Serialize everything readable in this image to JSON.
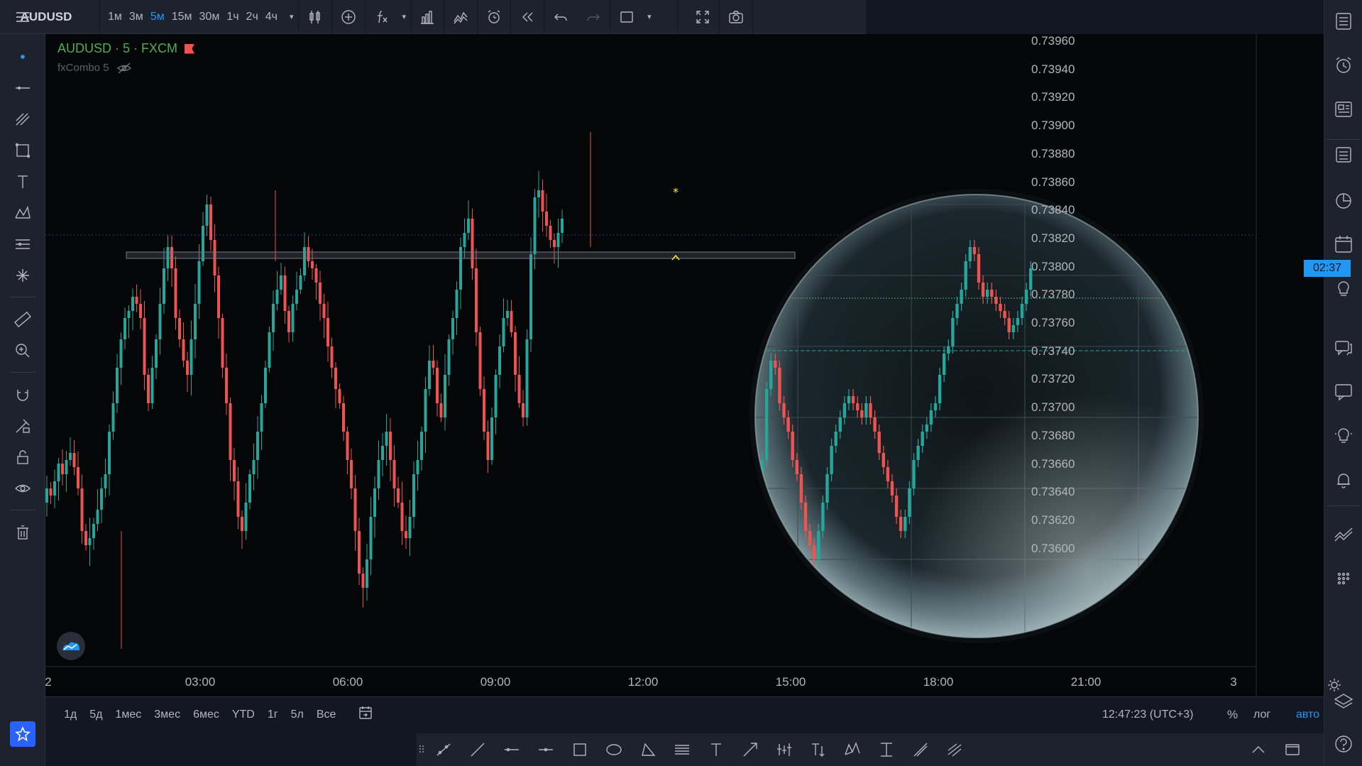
{
  "topbar": {
    "symbol": "AUDUSD",
    "intervals": [
      "1м",
      "3м",
      "5м",
      "15м",
      "30м",
      "1ч",
      "2ч",
      "4ч"
    ],
    "active_interval": "5м"
  },
  "legend": {
    "title": "AUDUSD · 5 · FXCM",
    "indicator": "fxCombo 5"
  },
  "price_scale": {
    "labels": [
      "0.73960",
      "0.73940",
      "0.73920",
      "0.73900",
      "0.73880",
      "0.73860",
      "0.73840",
      "0.73820",
      "0.73800",
      "0.73780",
      "0.73760",
      "0.73740",
      "0.73720",
      "0.73700",
      "0.73680",
      "0.73660",
      "0.73640",
      "0.73620",
      "0.73600"
    ],
    "countdown": "02:37"
  },
  "time_scale": {
    "labels": [
      "2",
      "03:00",
      "06:00",
      "09:00",
      "12:00",
      "15:00",
      "18:00",
      "21:00",
      "3"
    ]
  },
  "bottombar": {
    "ranges": [
      "1д",
      "5д",
      "1мес",
      "3мес",
      "6мес",
      "YTD",
      "1г",
      "5л",
      "Все"
    ],
    "clock": "12:47:23 (UTC+3)",
    "percent": "%",
    "log": "лог",
    "auto": "авто"
  },
  "colors": {
    "background": "#050608",
    "up": "#26a69a",
    "down": "#ef5350",
    "accent": "#2196f3",
    "panel": "#1e222d"
  },
  "icons": {
    "left": [
      "menu-icon",
      "crosshair-dot-icon",
      "trend-line-icon",
      "fib-icon",
      "rectangle-icon",
      "text-icon",
      "pattern-icon",
      "prediction-icon",
      "brush-icon",
      "ruler-icon",
      "zoom-in-icon",
      "magnet-icon",
      "lock-pencil-icon",
      "lock-icon",
      "eye-icon",
      "trash-icon",
      "star-icon"
    ],
    "right": [
      "watchlist-icon",
      "alarm-clock-icon",
      "news-icon",
      "data-window-icon",
      "hotlist-icon",
      "calendar-icon",
      "ideas-icon",
      "chats-icon",
      "chat-icon",
      "lightbulb-icon",
      "bell-icon",
      "chart-trend-icon",
      "dots-grid-icon",
      "layers-icon",
      "help-icon"
    ]
  }
}
